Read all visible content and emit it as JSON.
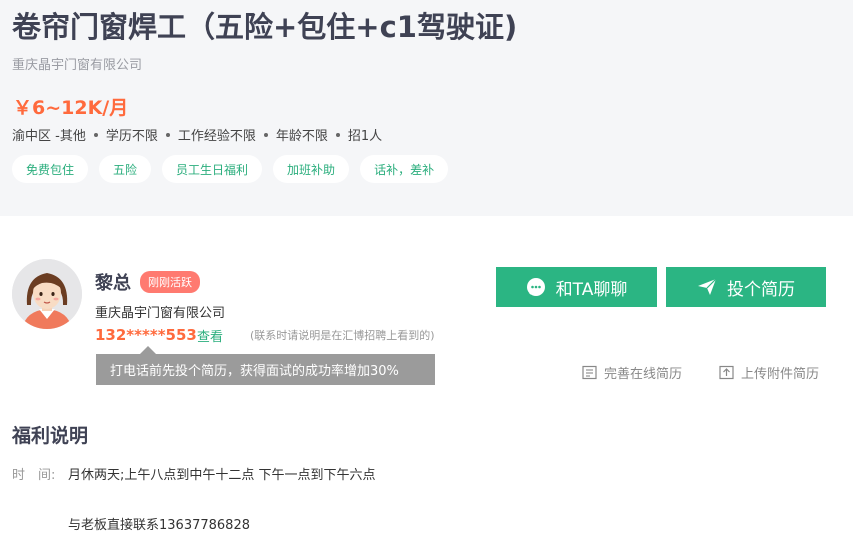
{
  "job": {
    "title": "卷帘门窗焊工（五险+包住+c1驾驶证)",
    "company": "重庆晶宇门窗有限公司",
    "salary": "￥6~12K/月",
    "requirements": [
      "渝中区 -其他",
      "学历不限",
      "工作经验不限",
      "年龄不限",
      "招1人"
    ],
    "tags": [
      "免费包住",
      "五险",
      "员工生日福利",
      "加班补助",
      "话补，差补"
    ]
  },
  "recruiter": {
    "name": "黎总",
    "badge": "刚刚活跃",
    "company": "重庆晶宇门窗有限公司",
    "phone": "132*****553",
    "view_label": "查看",
    "contact_note": "(联系时请说明是在汇博招聘上看到的)",
    "tooltip": "打电话前先投个简历，获得面试的成功率增加30%"
  },
  "actions": {
    "chat_label": "和TA聊聊",
    "apply_label": "投个简历",
    "complete_resume_label": "完善在线简历",
    "upload_resume_label": "上传附件简历"
  },
  "benefits": {
    "title": "福利说明",
    "time_label": "时　间:",
    "time_value": "月休两天;上午八点到中午十二点   下午一点到下午六点",
    "contact_line": "与老板直接联系13637786828"
  },
  "colors": {
    "accent_green": "#2bb583",
    "salary_orange": "#ff6a3d",
    "badge_red": "#ff7a70",
    "header_bg": "#f5f6f8"
  },
  "icons": {
    "chat": "chat-bubble-icon",
    "apply": "paper-plane-icon",
    "complete_resume": "document-icon",
    "upload_resume": "upload-icon"
  }
}
